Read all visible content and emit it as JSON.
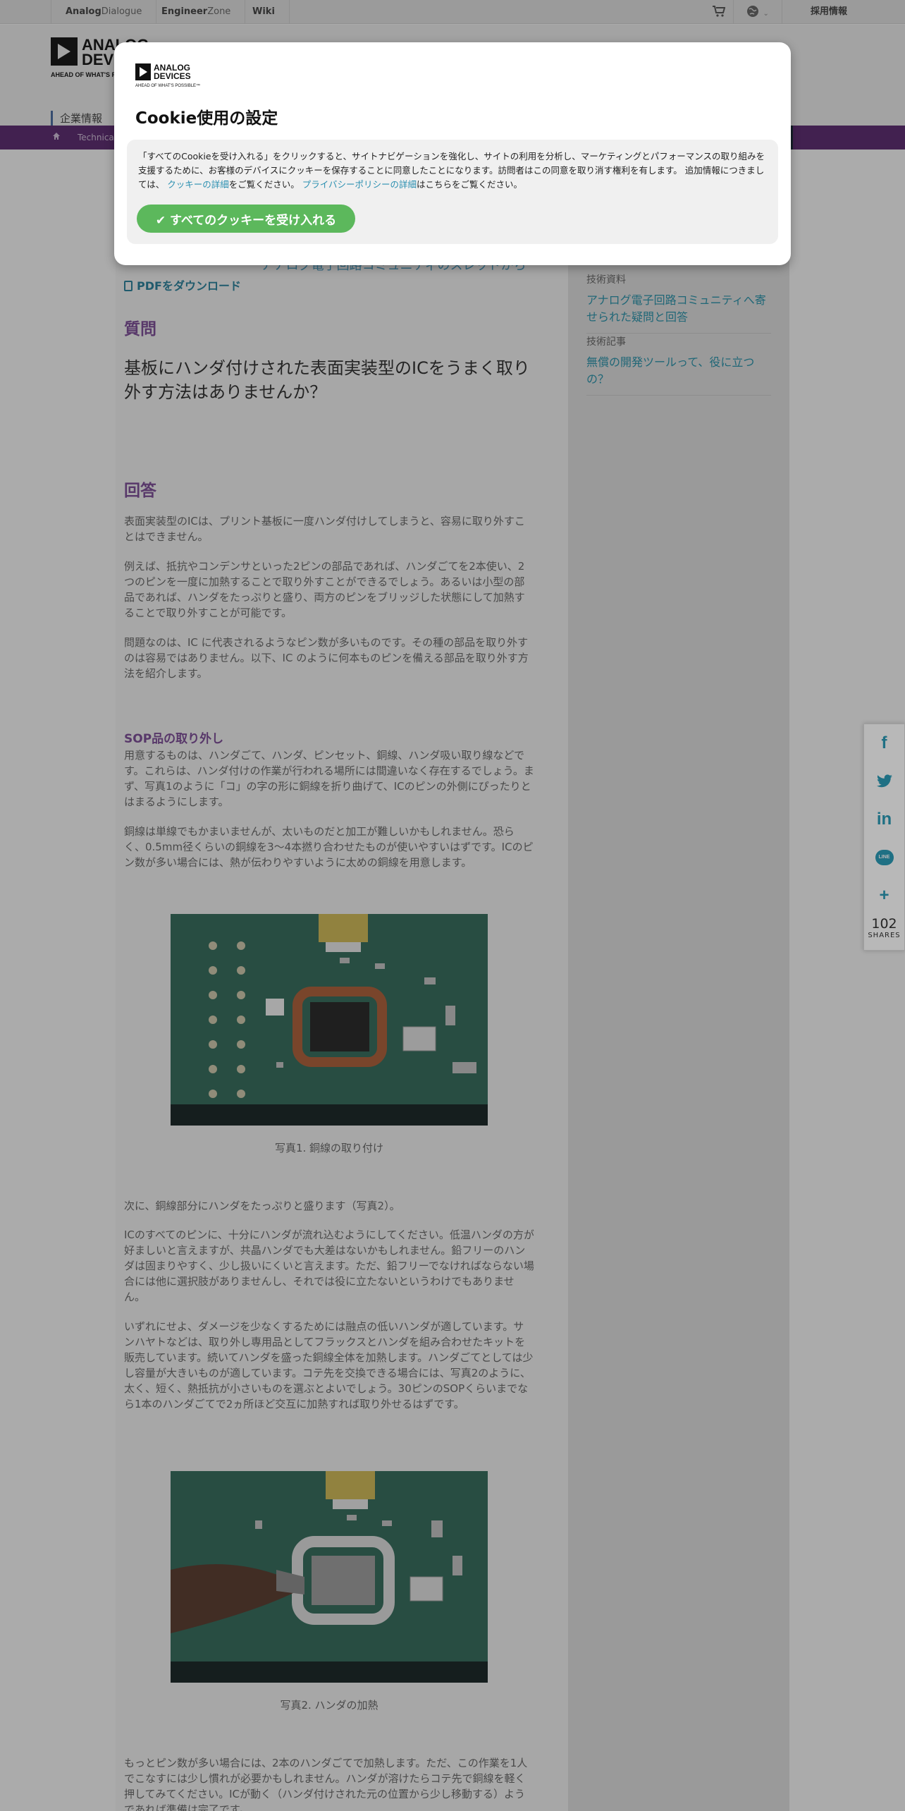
{
  "topbar": {
    "links": [
      {
        "bold": "Analog",
        "rest": "Dialogue"
      },
      {
        "bold": "Engineer",
        "rest": "Zone"
      },
      {
        "bold": "Wiki",
        "rest": ""
      }
    ],
    "cart_icon": "shopping-cart-icon",
    "globe_icon": "globe-icon",
    "careers": "採用情報"
  },
  "header": {
    "logo_line1": "ANALOG",
    "logo_line2": "DEVICES",
    "logo_tagline": "AHEAD OF WHAT'S POSSIBLE",
    "nav_corporate": "企業情報",
    "breadcrumb": "Technical"
  },
  "sidebar": {
    "sections": [
      {
        "category": "技術資料",
        "link": "アナログ電子回路コミュニティへ寄せられた疑問と回答"
      },
      {
        "category": "技術記事",
        "link": "無償の開発ツールって、役に立つの？"
      }
    ]
  },
  "article": {
    "partial_link": "アナログ電子回路コミュニティのスレッドから",
    "pdf_download": "PDFをダウンロード",
    "question_heading": "質問",
    "question": "基板にハンダ付けされた表面実装型のICをうまく取り外す方法はありませんか？",
    "answer_heading": "回答",
    "p1": "表面実装型のICは、プリント基板に一度ハンダ付けしてしまうと、容易に取り外すことはできません。",
    "p2": "例えば、抵抗やコンデンサといった2ピンの部品であれば、ハンダごてを2本使い、2つのピンを一度に加熱することで取り外すことができるでしょう。あるいは小型の部品であれば、ハンダをたっぷりと盛り、両方のピンをブリッジした状態にして加熱することで取り外すことが可能です。",
    "p3": "問題なのは、IC に代表されるようなピン数が多いものです。その種の部品を取り外すのは容易ではありません。以下、IC のように何本ものピンを備える部品を取り外す方法を紹介します。",
    "sop_heading": "SOP品の取り外し",
    "p4": "用意するものは、ハンダごて、ハンダ、ピンセット、銅線、ハンダ吸い取り線などです。これらは、ハンダ付けの作業が行われる場所には間違いなく存在するでしょう。まず、写真1のように「コ」の字の形に銅線を折り曲げて、ICのピンの外側にぴったりとはまるようにします。",
    "p5": "銅線は単線でもかまいませんが、太いものだと加工が難しいかもしれません。恐らく、0.5mm径くらいの銅線を3～4本撚り合わせたものが使いやすいはずです。ICのピン数が多い場合には、熱が伝わりやすいように太めの銅線を用意します。",
    "caption1": "写真1. 銅線の取り付け",
    "p6": "次に、銅線部分にハンダをたっぷりと盛ります（写真2）。",
    "p7": "ICのすべてのピンに、十分にハンダが流れ込むようにしてください。低温ハンダの方が好ましいと言えますが、共晶ハンダでも大差はないかもしれません。鉛フリーのハンダは固まりやすく、少し扱いにくいと言えます。ただ、鉛フリーでなければならない場合には他に選択肢がありませんし、それでは役に立たないというわけでもありません。",
    "p8": "いずれにせよ、ダメージを少なくするためには融点の低いハンダが適しています。サンハヤトなどは、取り外し専用品としてフラックスとハンダを組み合わせたキットを販売しています。続いてハンダを盛った銅線全体を加熱します。ハンダごてとしては少し容量が大きいものが適しています。コテ先を交換できる場合には、写真2のように、太く、短く、熱抵抗が小さいものを選ぶとよいでしょう。30ピンのSOPくらいまでなら1本のハンダごてで2ヵ所ほど交互に加熱すれば取り外せるはずです。",
    "caption2": "写真2. ハンダの加熱",
    "p9": "もっとピン数が多い場合には、2本のハンダごてで加熱します。ただ、この作業を1人でこなすには少し慣れが必要かもしれません。ハンダが溶けたらコテ先で銅線を軽く押してみてください。ICが動く（ハンダ付けされた元の位置から少し移動する）ようであれば準備は完了です。"
  },
  "share": {
    "facebook": "f",
    "twitter": "twitter-icon",
    "linkedin": "in",
    "line": "LINE",
    "more": "+",
    "count": "102",
    "label": "SHARES"
  },
  "cookie": {
    "logo_line1": "ANALOG",
    "logo_line2": "DEVICES",
    "logo_tagline": "AHEAD OF WHAT'S POSSIBLE™",
    "title": "Cookie使用の設定",
    "text_before": "「すべてのCookieを受け入れる」をクリックすると、サイトナビゲーションを強化し、サイトの利用を分析し、マーケティングとパフォーマンスの取り組みを支援するために、お客様のデバイスにクッキーを保存することに同意したことになります。訪問者はこの同意を取り消す権利を有します。 追加情報につきましては、 ",
    "cookie_link": "クッキーの詳細",
    "text_mid": "をご覧ください。 ",
    "privacy_link": "プライバシーポリシーの詳細",
    "text_after": "はこちらをご覧ください。",
    "accept_label": "すべてのクッキーを受け入れる",
    "accept_icon": "check-icon"
  }
}
